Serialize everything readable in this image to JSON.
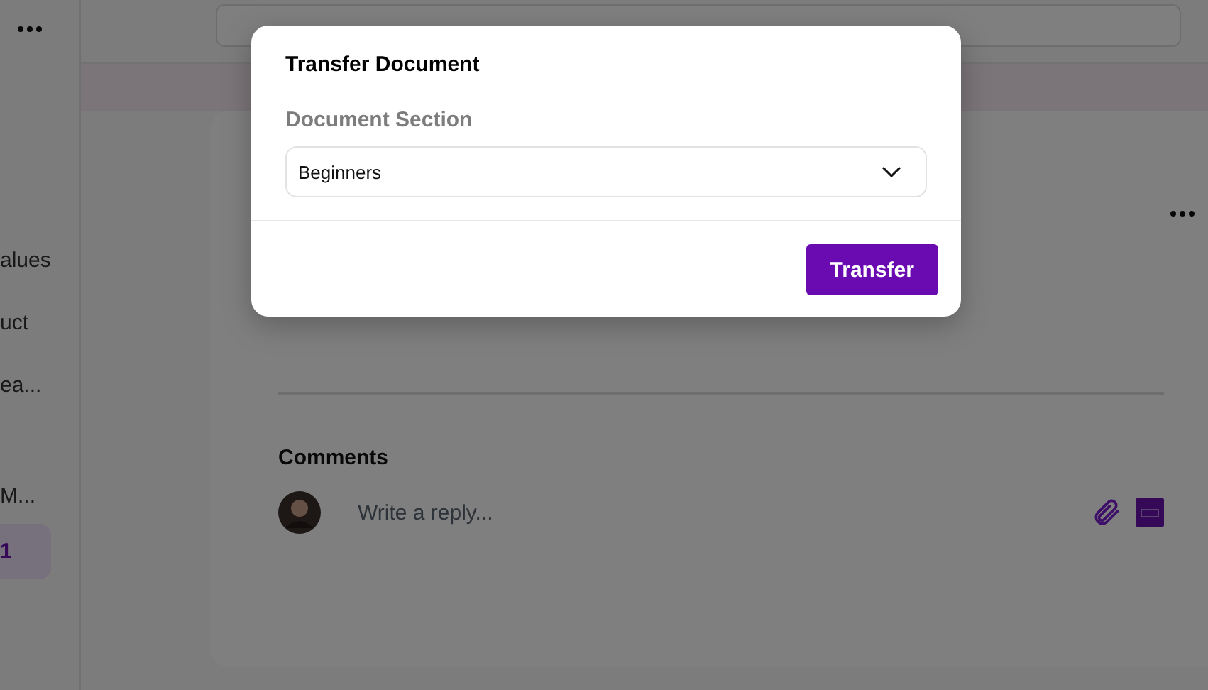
{
  "sidebar": {
    "items": [
      {
        "label": "alues",
        "selected": false
      },
      {
        "label": "uct",
        "selected": false
      },
      {
        "label": "ea...",
        "selected": false
      },
      {
        "label": "M...",
        "selected": false
      },
      {
        "label": "1",
        "selected": true
      }
    ]
  },
  "comments": {
    "title": "Comments",
    "reply": {
      "placeholder": "Write a reply..."
    }
  },
  "dialog": {
    "title": "Transfer Document",
    "field_label": "Document Section",
    "value": "Beginners",
    "button": "Transfer"
  }
}
